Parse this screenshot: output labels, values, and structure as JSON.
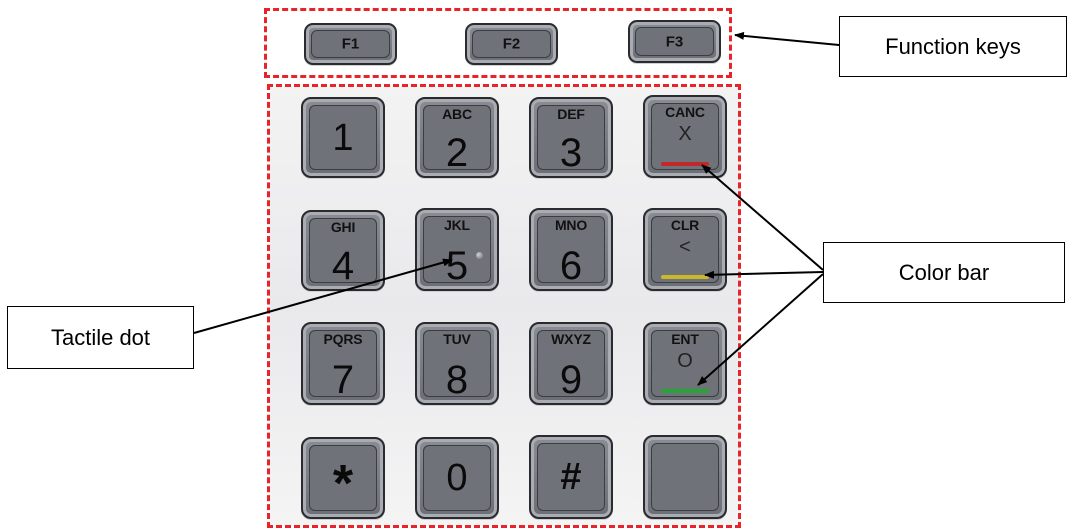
{
  "function_keys": [
    "F1",
    "F2",
    "F3"
  ],
  "keypad": [
    {
      "letters": "",
      "digit": "1"
    },
    {
      "letters": "ABC",
      "digit": "2"
    },
    {
      "letters": "DEF",
      "digit": "3"
    },
    {
      "letters": "CANC",
      "symbol": "X",
      "bar_color": "#c0282a"
    },
    {
      "letters": "GHI",
      "digit": "4"
    },
    {
      "letters": "JKL",
      "digit": "5",
      "tactile_dot": true
    },
    {
      "letters": "MNO",
      "digit": "6"
    },
    {
      "letters": "CLR",
      "symbol": "<",
      "bar_color": "#c8b82a"
    },
    {
      "letters": "PQRS",
      "digit": "7"
    },
    {
      "letters": "TUV",
      "digit": "8"
    },
    {
      "letters": "WXYZ",
      "digit": "9"
    },
    {
      "letters": "ENT",
      "symbol": "O",
      "bar_color": "#25a535"
    },
    {
      "letters": "",
      "digit": "*"
    },
    {
      "letters": "",
      "digit": "0"
    },
    {
      "letters": "",
      "digit": "#"
    },
    {
      "letters": "",
      "digit": ""
    }
  ],
  "callouts": {
    "function_keys": "Function keys",
    "color_bar": "Color bar",
    "tactile_dot": "Tactile dot"
  },
  "colors": {
    "region_outline": "#e8242a",
    "key_face": "#6f7279",
    "cancel_bar": "#c0282a",
    "clear_bar": "#c8b82a",
    "enter_bar": "#25a535"
  }
}
